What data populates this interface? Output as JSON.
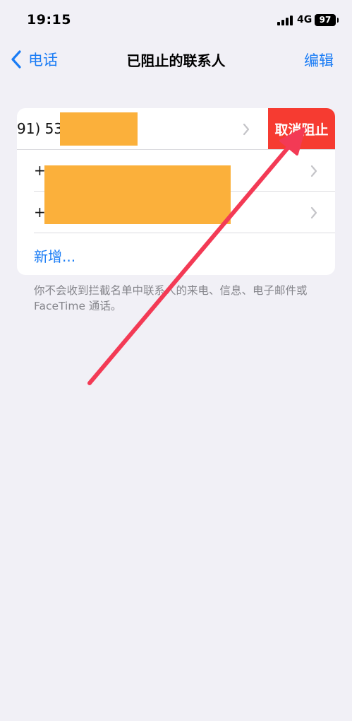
{
  "status_bar": {
    "time": "19:15",
    "network": "4G",
    "battery": "97",
    "signal_icon": "signal-bars-icon"
  },
  "nav": {
    "back_label": "电话",
    "back_icon": "chevron-left-icon",
    "title": "已阻止的联系人",
    "edit_label": "编辑"
  },
  "blocked_list": {
    "rows": [
      {
        "number": "91) 53",
        "action_label": "取消阻止"
      },
      {
        "number": "+"
      },
      {
        "number": "+"
      }
    ],
    "add_new_label": "新增...",
    "chevron_icon": "chevron-right-icon"
  },
  "footer": {
    "note": "你不会收到拦截名单中联系人的来电、信息、电子邮件或 FaceTime 通话。"
  },
  "colors": {
    "accent": "#1a7cf5",
    "destructive": "#f63b31",
    "redaction": "#fbb03b",
    "annotation": "#f33a55",
    "background": "#f1f0f6"
  }
}
